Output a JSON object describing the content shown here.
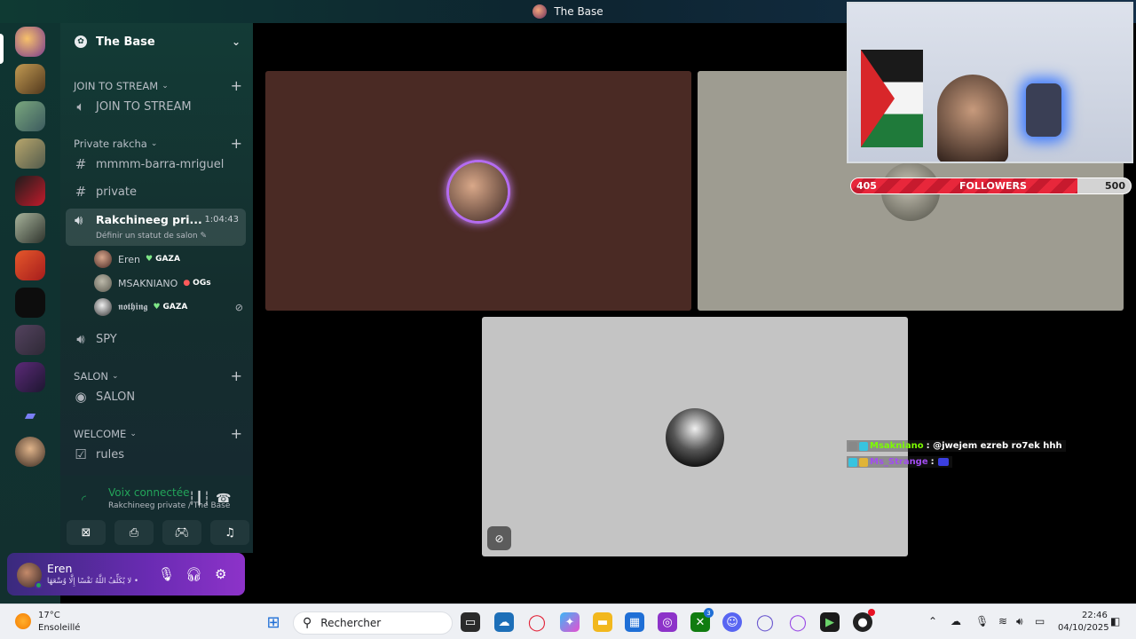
{
  "window": {
    "title": "The Base"
  },
  "guild": {
    "name": "The Base"
  },
  "categories": {
    "join": "JOIN TO STREAM",
    "private": "Private rakcha",
    "salon": "SALON",
    "welcome": "WELCOME"
  },
  "channels": {
    "join_to_stream": "JOIN TO STREAM",
    "mmmm": "mmmm-barra-mriguel",
    "private": "private",
    "rakchineeg": "Rakchineeg pri...",
    "rakchineeg_time": "1:04:43",
    "rakchineeg_status": "Définir un statut de salon",
    "spy": "SPY",
    "salon": "SALON",
    "rules": "rules"
  },
  "voice_users": [
    {
      "name": "Eren",
      "tag": "GAZA",
      "tag_icon": "green-heart"
    },
    {
      "name": "MSAKNIANO",
      "tag": "OGs",
      "tag_icon": "apple"
    },
    {
      "name": "𝖓𝖔𝖙𝖍𝖎𝖓𝖌",
      "tag": "GAZA",
      "tag_icon": "green-heart"
    }
  ],
  "voice_panel": {
    "title": "Voix connectée",
    "subtitle": "Rakchineeg private / The Base"
  },
  "user_panel": {
    "name": "Eren",
    "status": "لا يُكَلِّفُ اللَّهُ نَفْسًا إِلَّا وُسْعَهَا •"
  },
  "overlay": {
    "followers_label": "FOLLOWERS",
    "followers_current": "405",
    "followers_goal": "500",
    "followers_progress": 0.81,
    "chat": [
      {
        "user": "Msakniano",
        "message": ": @jwejem ezreb ro7ek hhh",
        "user_color": "#7cfc00"
      },
      {
        "user": "Ms_Strange",
        "message": ":",
        "user_color": "#a24df0"
      }
    ]
  },
  "taskbar": {
    "temp": "17°C",
    "condition": "Ensoleillé",
    "search_placeholder": "Rechercher",
    "time": "22:46",
    "date": "04/10/2025",
    "xbox_badge": "3"
  },
  "colors": {
    "sidebar_bg": "#133b36",
    "user_panel_accent": "#6a2bb3",
    "tile_brown": "#4a2a24",
    "tile_gray": "#9e9c91",
    "tile_light": "#c4c4c4"
  }
}
